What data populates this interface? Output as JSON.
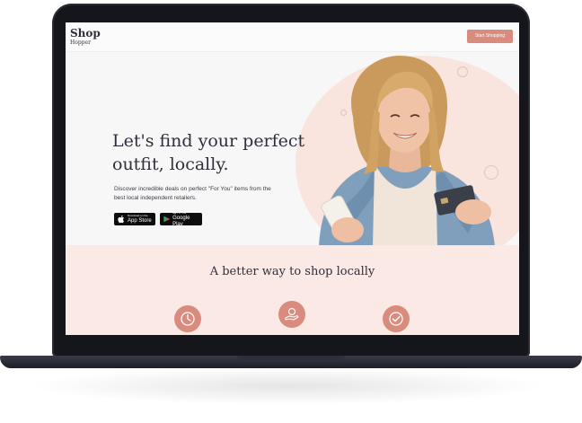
{
  "colors": {
    "accent": "#d98b7d",
    "hero_blob": "#f9e4de",
    "section_bg": "#fae9e5",
    "text_dark": "#2e2f3c"
  },
  "nav": {
    "logo_main": "Shop",
    "logo_sub": "Hopper",
    "cta_label": "Start Shopping"
  },
  "hero": {
    "title": "Let's find your perfect outfit, locally.",
    "description": "Discover incredible deals on perfect \"For You\" items from the best local independent retailers.",
    "app_store": {
      "small": "Download on the",
      "big": "App Store",
      "icon": "apple-icon"
    },
    "google_play": {
      "small": "GET IT ON",
      "big": "Google Play",
      "icon": "google-play-icon"
    }
  },
  "features_section": {
    "title": "A better way to shop locally",
    "icons": [
      "clock-icon",
      "hand-coin-icon",
      "checkmark-badge-icon"
    ]
  }
}
